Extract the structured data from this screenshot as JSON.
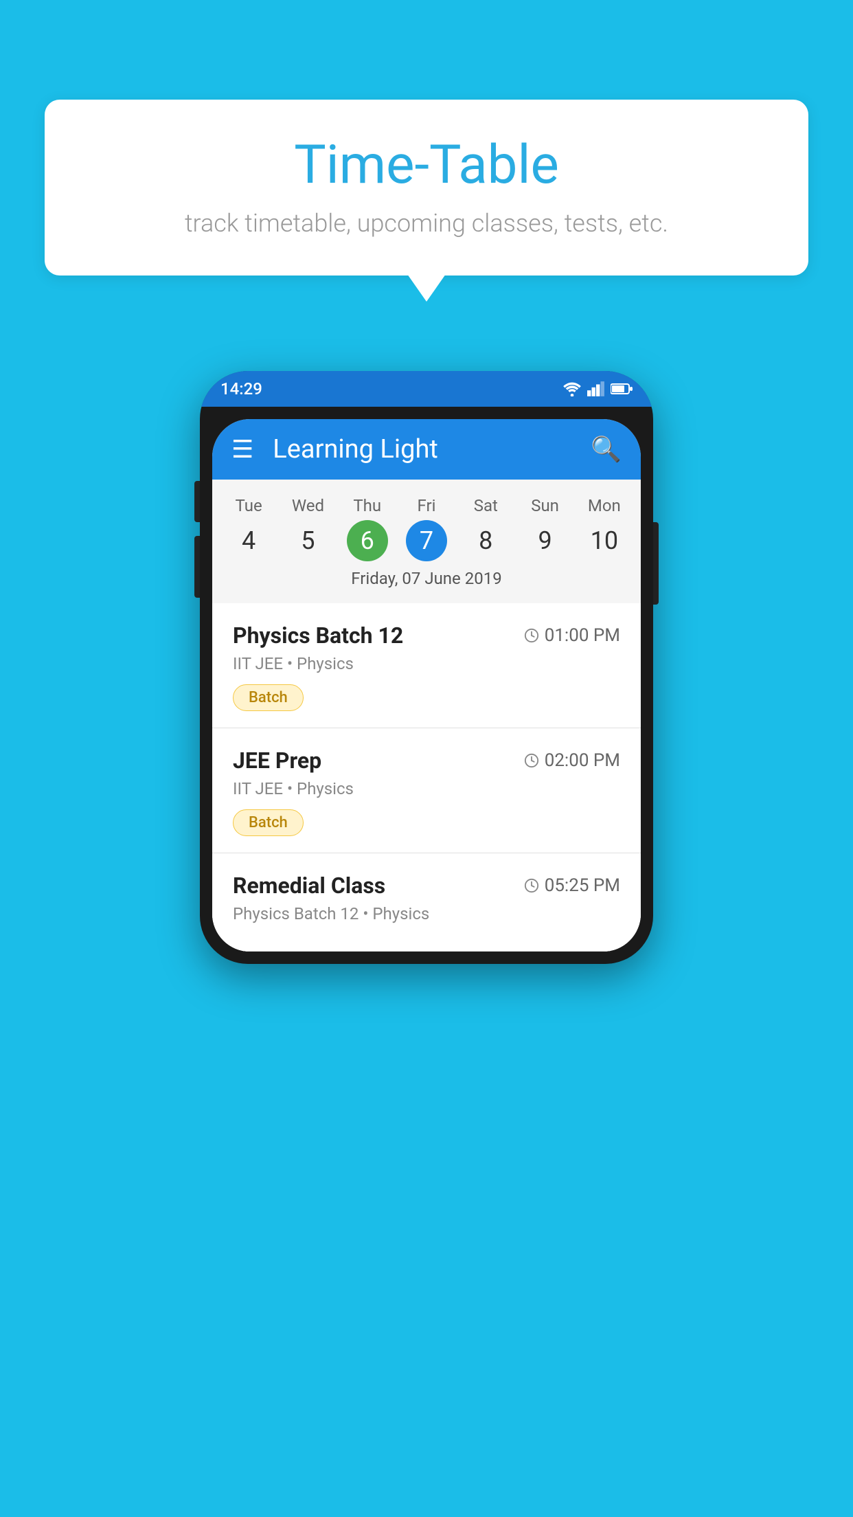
{
  "background_color": "#1BBDE8",
  "speech_bubble": {
    "title": "Time-Table",
    "subtitle": "track timetable, upcoming classes, tests, etc."
  },
  "phone": {
    "status_bar": {
      "time": "14:29"
    },
    "app_bar": {
      "title": "Learning Light"
    },
    "calendar": {
      "days": [
        "Tue",
        "Wed",
        "Thu",
        "Fri",
        "Sat",
        "Sun",
        "Mon"
      ],
      "numbers": [
        "4",
        "5",
        "6",
        "7",
        "8",
        "9",
        "10"
      ],
      "today_index": 2,
      "selected_index": 3,
      "date_label": "Friday, 07 June 2019"
    },
    "schedule": [
      {
        "title": "Physics Batch 12",
        "time": "01:00 PM",
        "subtitle": "IIT JEE • Physics",
        "badge": "Batch"
      },
      {
        "title": "JEE Prep",
        "time": "02:00 PM",
        "subtitle": "IIT JEE • Physics",
        "badge": "Batch"
      },
      {
        "title": "Remedial Class",
        "time": "05:25 PM",
        "subtitle": "Physics Batch 12 • Physics",
        "badge": ""
      }
    ]
  },
  "icons": {
    "hamburger": "≡",
    "search": "🔍",
    "clock": "🕐"
  }
}
